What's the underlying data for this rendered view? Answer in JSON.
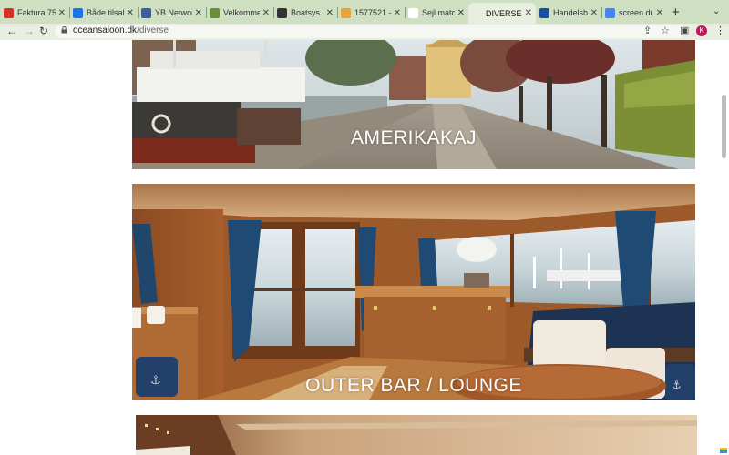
{
  "browser": {
    "tabs": [
      {
        "title": "Faktura 75",
        "fav_color": "#d93025"
      },
      {
        "title": "Både tilsalg",
        "fav_color": "#1a73e8"
      },
      {
        "title": "YB Network",
        "fav_color": "#3a5fa8"
      },
      {
        "title": "Velkommen",
        "fav_color": "#6a8f3a"
      },
      {
        "title": "Boatsys -",
        "fav_color": "#333333"
      },
      {
        "title": "1577521 -",
        "fav_color": "#e8a33c"
      },
      {
        "title": "Sejl match",
        "fav_color": "#ffffff"
      },
      {
        "title": "DIVERSE |",
        "fav_color": "#e8efe0",
        "active": true
      },
      {
        "title": "Handelsbo",
        "fav_color": "#1a4f9c"
      },
      {
        "title": "screen dur",
        "fav_color": "#4285f4"
      }
    ],
    "new_tab": "+",
    "address": {
      "domain": "oceansaloon.dk",
      "path": "/diverse"
    },
    "profile_initial": "K",
    "accent": "#c2185b"
  },
  "page": {
    "sections": [
      {
        "caption": "AMERIKAKAJ",
        "photo": "harbor-quay-photo"
      },
      {
        "caption": "OUTER BAR / LOUNGE",
        "photo": "boat-lounge-interior-photo"
      },
      {
        "caption": "",
        "photo": "boat-interior-photo-partial"
      }
    ]
  }
}
